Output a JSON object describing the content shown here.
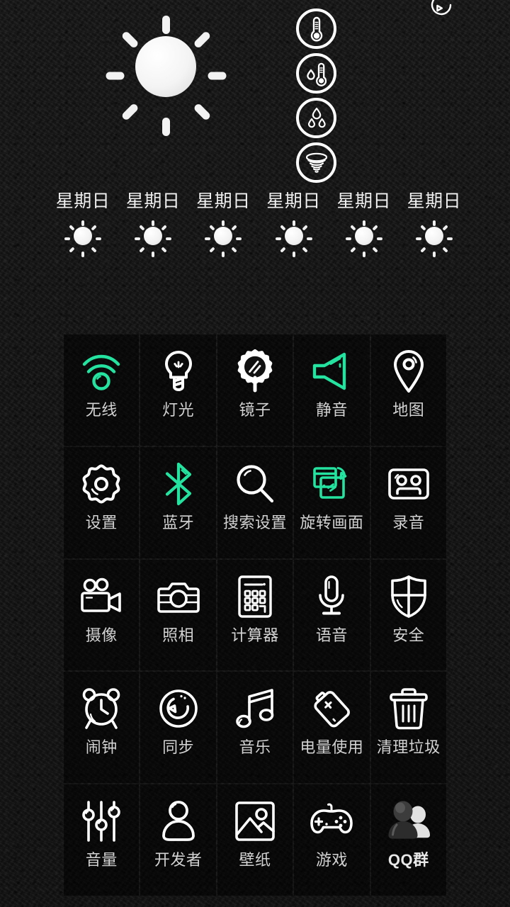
{
  "theme": {
    "accent_green": "#24E2A0",
    "icon_white": "#FFFFFF",
    "label_gray": "#D2D2D2",
    "background": "#181818",
    "tile_background": "#0A0A0A"
  },
  "weather": {
    "current_condition_icon": "sun-icon",
    "refresh_icon": "refresh-icon",
    "metrics": [
      {
        "icon": "thermometer-icon",
        "name": "temperature"
      },
      {
        "icon": "thermometer-humidity-icon",
        "name": "feels-like-humidity"
      },
      {
        "icon": "raindrops-icon",
        "name": "precipitation"
      },
      {
        "icon": "tornado-wind-icon",
        "name": "wind"
      }
    ],
    "forecast": [
      {
        "day": "星期日",
        "icon": "sun-icon"
      },
      {
        "day": "星期日",
        "icon": "sun-icon"
      },
      {
        "day": "星期日",
        "icon": "sun-icon"
      },
      {
        "day": "星期日",
        "icon": "sun-icon"
      },
      {
        "day": "星期日",
        "icon": "sun-icon"
      },
      {
        "day": "星期日",
        "icon": "sun-icon"
      }
    ]
  },
  "app_grid": {
    "apps": [
      {
        "label": "无线",
        "icon": "wifi-icon",
        "color": "green"
      },
      {
        "label": "灯光",
        "icon": "lightbulb-icon",
        "color": "white"
      },
      {
        "label": "镜子",
        "icon": "mirror-icon",
        "color": "white"
      },
      {
        "label": "静音",
        "icon": "speaker-mute-icon",
        "color": "green"
      },
      {
        "label": "地图",
        "icon": "map-pin-icon",
        "color": "white"
      },
      {
        "label": "设置",
        "icon": "gear-icon",
        "color": "white"
      },
      {
        "label": "蓝牙",
        "icon": "bluetooth-icon",
        "color": "green"
      },
      {
        "label": "搜索设置",
        "icon": "search-icon",
        "color": "white"
      },
      {
        "label": "旋转画面",
        "icon": "rotate-screen-icon",
        "color": "green"
      },
      {
        "label": "录音",
        "icon": "cassette-icon",
        "color": "white"
      },
      {
        "label": "摄像",
        "icon": "video-camera-icon",
        "color": "white"
      },
      {
        "label": "照相",
        "icon": "camera-icon",
        "color": "white"
      },
      {
        "label": "计算器",
        "icon": "calculator-icon",
        "color": "white"
      },
      {
        "label": "语音",
        "icon": "microphone-icon",
        "color": "white"
      },
      {
        "label": "安全",
        "icon": "shield-icon",
        "color": "white"
      },
      {
        "label": "闹钟",
        "icon": "alarm-clock-icon",
        "color": "white"
      },
      {
        "label": "同步",
        "icon": "sync-icon",
        "color": "white"
      },
      {
        "label": "音乐",
        "icon": "music-note-icon",
        "color": "white"
      },
      {
        "label": "电量使用",
        "icon": "battery-icon",
        "color": "white"
      },
      {
        "label": "清理垃圾",
        "icon": "trash-can-icon",
        "color": "white"
      },
      {
        "label": "音量",
        "icon": "sliders-icon",
        "color": "white"
      },
      {
        "label": "开发者",
        "icon": "person-icon",
        "color": "white"
      },
      {
        "label": "壁纸",
        "icon": "picture-icon",
        "color": "white"
      },
      {
        "label": "游戏",
        "icon": "gamepad-icon",
        "color": "white"
      },
      {
        "label": "QQ群",
        "icon": "qq-group-icon",
        "color": "filled"
      }
    ]
  }
}
